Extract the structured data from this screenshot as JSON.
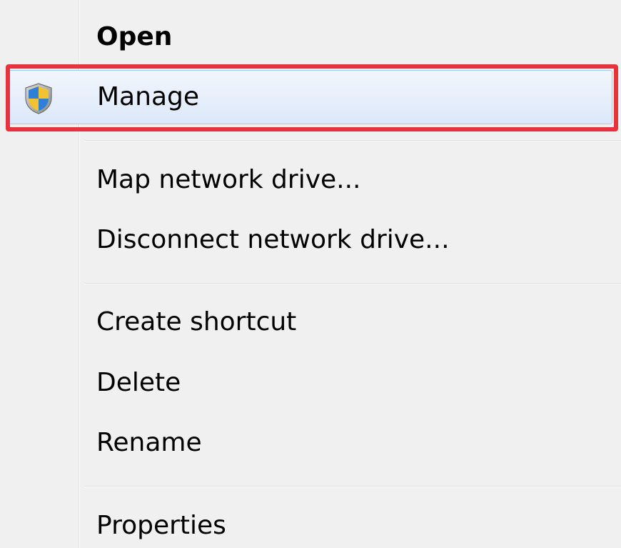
{
  "context_menu": {
    "items": [
      {
        "label": "Open",
        "bold": true
      },
      {
        "label": "Manage",
        "icon": "uac-shield-icon",
        "highlighted": true
      },
      {
        "label": "Map network drive..."
      },
      {
        "label": "Disconnect network drive..."
      },
      {
        "label": "Create shortcut"
      },
      {
        "label": "Delete"
      },
      {
        "label": "Rename"
      },
      {
        "label": "Properties"
      }
    ],
    "colors": {
      "background": "#f0f0f0",
      "hover_fill": "#e6eefb",
      "hover_border": "#a8c8ee",
      "annotation_box": "#e8323c",
      "shield_blue": "#2f7fd6",
      "shield_yellow": "#f2c230"
    }
  }
}
